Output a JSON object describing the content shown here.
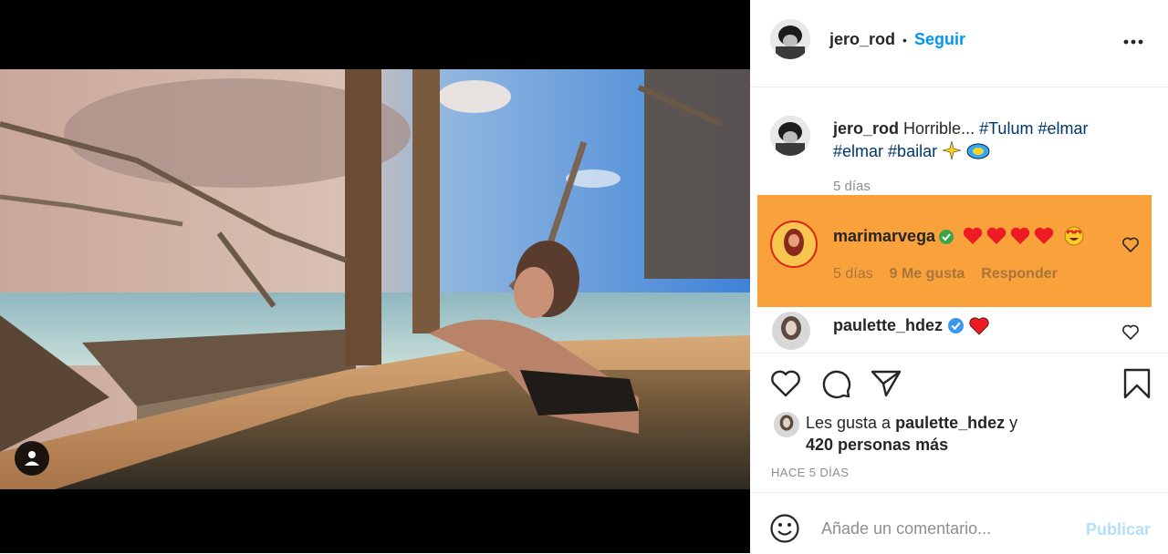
{
  "post": {
    "author": "jero_rod",
    "follow_label": "Seguir",
    "dot": "•",
    "more_label": "•••"
  },
  "caption": {
    "author": "jero_rod",
    "text": "Horrible...",
    "tags": [
      "#Tulum",
      "#elmar",
      "#elmar",
      "#bailar"
    ],
    "emojis": [
      "sparkles-emoji",
      "fish-cake-emoji"
    ],
    "time": "5 días"
  },
  "comments": [
    {
      "user": "marimarvega",
      "verified": true,
      "hearts": 4,
      "extra_emoji": "heart-eyes-emoji",
      "time": "5 días",
      "likes": "9 Me gusta",
      "reply": "Responder",
      "highlighted": true
    },
    {
      "user": "paulette_hdez",
      "verified": true,
      "hearts": 1
    }
  ],
  "likes": {
    "prefix": "Les gusta a",
    "user": "paulette_hdez",
    "joiner": "y",
    "others": "420 personas más",
    "time": "HACE 5 DÍAS"
  },
  "composer": {
    "placeholder": "Añade un comentario...",
    "publish_label": "Publicar"
  },
  "colors": {
    "accent": "#0095f6",
    "highlight": "#f9a13b",
    "verified": "#3897f0",
    "heart_red": "#ed1c24"
  },
  "icons": [
    "user-tag-icon",
    "more-icon",
    "like-icon",
    "comment-icon",
    "share-icon",
    "save-icon",
    "emoji-icon",
    "verified-icon",
    "small-heart-icon"
  ]
}
